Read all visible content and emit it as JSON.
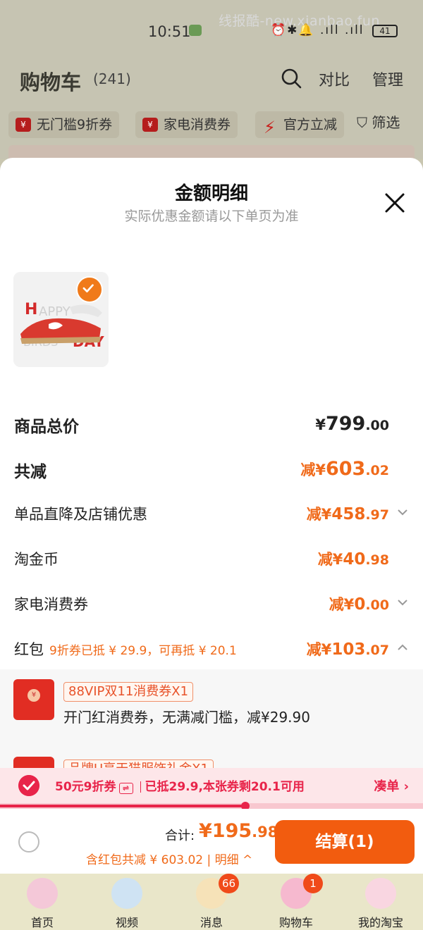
{
  "status_bar": {
    "time": "10:51",
    "watermark": "线报酷-new.xianbao.fun",
    "icons": "⏰✱🔔 .ıll .ıll",
    "battery": "41"
  },
  "header": {
    "title": "购物车",
    "count": "(241)",
    "compare": "对比",
    "manage": "管理"
  },
  "filters": {
    "chips": [
      "无门槛9折券",
      "家电消费券",
      "官方立减"
    ],
    "filter_label": "筛选"
  },
  "sheet": {
    "title": "金额明细",
    "subtitle": "实际优惠金额请以下单页为准",
    "rows": [
      {
        "label": "商品总价",
        "prefix": "¥",
        "int": "799",
        "dec": ".00"
      },
      {
        "label": "共减",
        "prefix": "减¥",
        "int": "603",
        "dec": ".02"
      },
      {
        "label": "单品直降及店铺优惠",
        "prefix": "减¥",
        "int": "458",
        "dec": ".97"
      },
      {
        "label": "淘金币",
        "prefix": "减¥",
        "int": "40",
        "dec": ".98"
      },
      {
        "label": "家电消费券",
        "prefix": "减¥",
        "int": "0",
        "dec": ".00"
      },
      {
        "label": "红包",
        "hint": "9折券已抵 ¥ 29.9，可再抵 ¥ 20.1",
        "prefix": "减¥",
        "int": "103",
        "dec": ".07"
      }
    ],
    "red_packets": [
      {
        "tag": "88VIP双11消费券X1",
        "desc": "开门红消费券，无满减门槛，减¥29.90"
      },
      {
        "tag": "品牌U享天猫服饰礼金X1",
        "desc": ""
      }
    ]
  },
  "coupon_bar": {
    "coupon": "50元9折券",
    "swap": "⇌",
    "text": "已抵29.9,本张券剩20.1可用",
    "more": "凑单 ›",
    "progress": 0.58
  },
  "checkout": {
    "total_label": "合计:",
    "total_int": "¥195",
    "total_dec": ".98",
    "sub": "含红包共减 ¥ 603.02 | 明细 ^",
    "pay": "结算(1)"
  },
  "tabs": [
    {
      "label": "首页",
      "badge": ""
    },
    {
      "label": "视频",
      "badge": ""
    },
    {
      "label": "消息",
      "badge": "66"
    },
    {
      "label": "购物车",
      "badge": "1"
    },
    {
      "label": "我的淘宝",
      "badge": ""
    }
  ]
}
